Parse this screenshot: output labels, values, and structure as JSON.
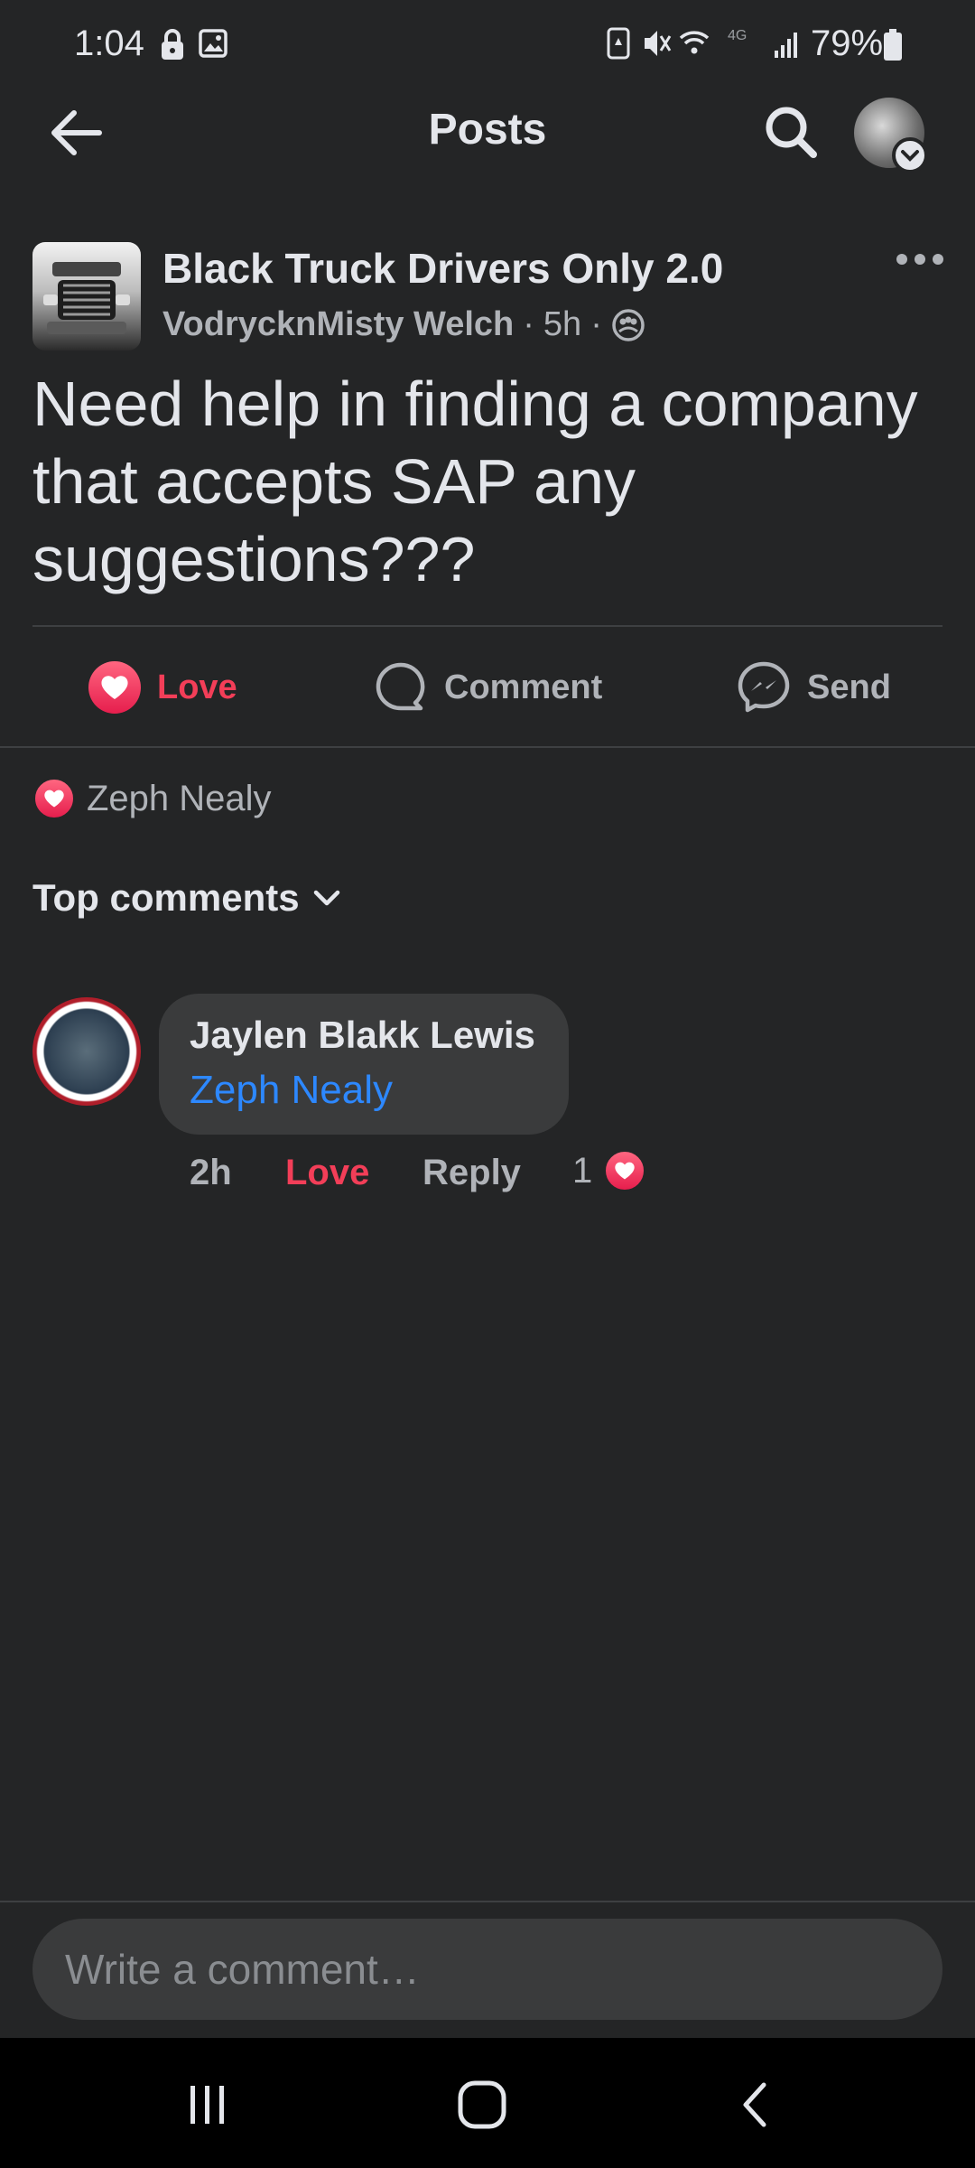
{
  "status_bar": {
    "time": "1:04",
    "battery": "79%",
    "network": "4G"
  },
  "app_bar": {
    "title": "Posts"
  },
  "post": {
    "group_name": "Black Truck Drivers Only 2.0",
    "author": "VodrycknMisty Welch",
    "separator_1": "·",
    "time": "5h",
    "separator_2": "·",
    "text": "Need help in finding a company that accepts SAP any suggestions???"
  },
  "actions": {
    "love": "Love",
    "comment": "Comment",
    "send": "Send"
  },
  "reactions": {
    "name": "Zeph Nealy"
  },
  "comments_section": {
    "filter_label": "Top comments",
    "comments": [
      {
        "author": "Jaylen Blakk Lewis",
        "mention": "Zeph Nealy",
        "time": "2h",
        "love": "Love",
        "reply": "Reply",
        "reaction_count": "1"
      }
    ]
  },
  "composer": {
    "placeholder": "Write a comment…"
  },
  "colors": {
    "background": "#242526",
    "love_red": "#f33e58",
    "mention_blue": "#2d88ff",
    "secondary_text": "#b0b3b8"
  },
  "icons": {
    "status": [
      "lock-icon",
      "image-icon",
      "battery-saver-icon",
      "mute-icon",
      "wifi-icon",
      "signal-icon",
      "battery-icon"
    ],
    "nav": [
      "recent-apps-icon",
      "home-icon",
      "back-icon"
    ]
  }
}
